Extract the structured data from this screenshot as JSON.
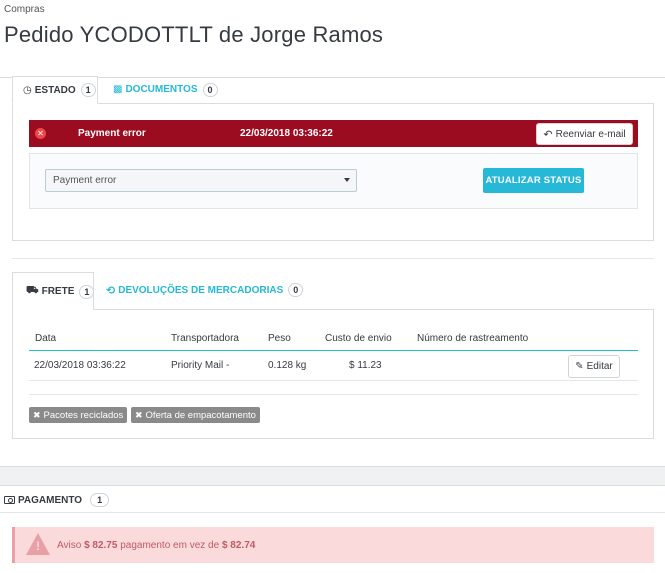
{
  "breadcrumb": "Compras",
  "page_title": "Pedido YCODOTTLT de Jorge Ramos",
  "status_tabs": {
    "estado": {
      "label": "ESTADO",
      "count": "1"
    },
    "documentos": {
      "label": "DOCUMENTOS",
      "count": "0"
    }
  },
  "status_history": {
    "status": "Payment error",
    "date": "22/03/2018 03:36:22",
    "resend_label": "Reenviar e-mail",
    "status_color": "#9b0c20"
  },
  "status_form": {
    "selected_status": "Payment error",
    "update_label": "ATUALIZAR STATUS"
  },
  "shipping_tabs": {
    "frete": {
      "label": "FRETE",
      "count": "1"
    },
    "devolucoes": {
      "label": "DEVOLUÇÕES DE MERCADORIAS",
      "count": "0"
    }
  },
  "shipping_table": {
    "headers": [
      "Data",
      "Transportadora",
      "Peso",
      "Custo de envio",
      "Número de rastreamento"
    ],
    "rows": [
      {
        "date": "22/03/2018 03:36:22",
        "carrier": "Priority Mail -",
        "weight": "0.128 kg",
        "cost": "$ 11.23",
        "tracking": "",
        "edit_label": "Editar"
      }
    ]
  },
  "tags": [
    "Pacotes reciclados",
    "Oferta de empacotamento"
  ],
  "payment": {
    "label": "PAGAMENTO",
    "count": "1",
    "warning_prefix": "Aviso",
    "paid_amount": "$ 82.75",
    "warning_middle": "pagamento em vez de",
    "expected_amount": "$ 82.74"
  },
  "colors": {
    "accent": "#25b9d7",
    "danger_bar": "#9b0c20",
    "alert_bg": "#fbdadc",
    "tag_bg": "#8a8a8a"
  },
  "icons": [
    "clock-icon",
    "document-icon",
    "close-circle-icon",
    "reply-icon",
    "chevron-down-icon",
    "truck-icon",
    "undo-icon",
    "pencil-icon",
    "x-icon",
    "money-icon",
    "warning-icon"
  ]
}
